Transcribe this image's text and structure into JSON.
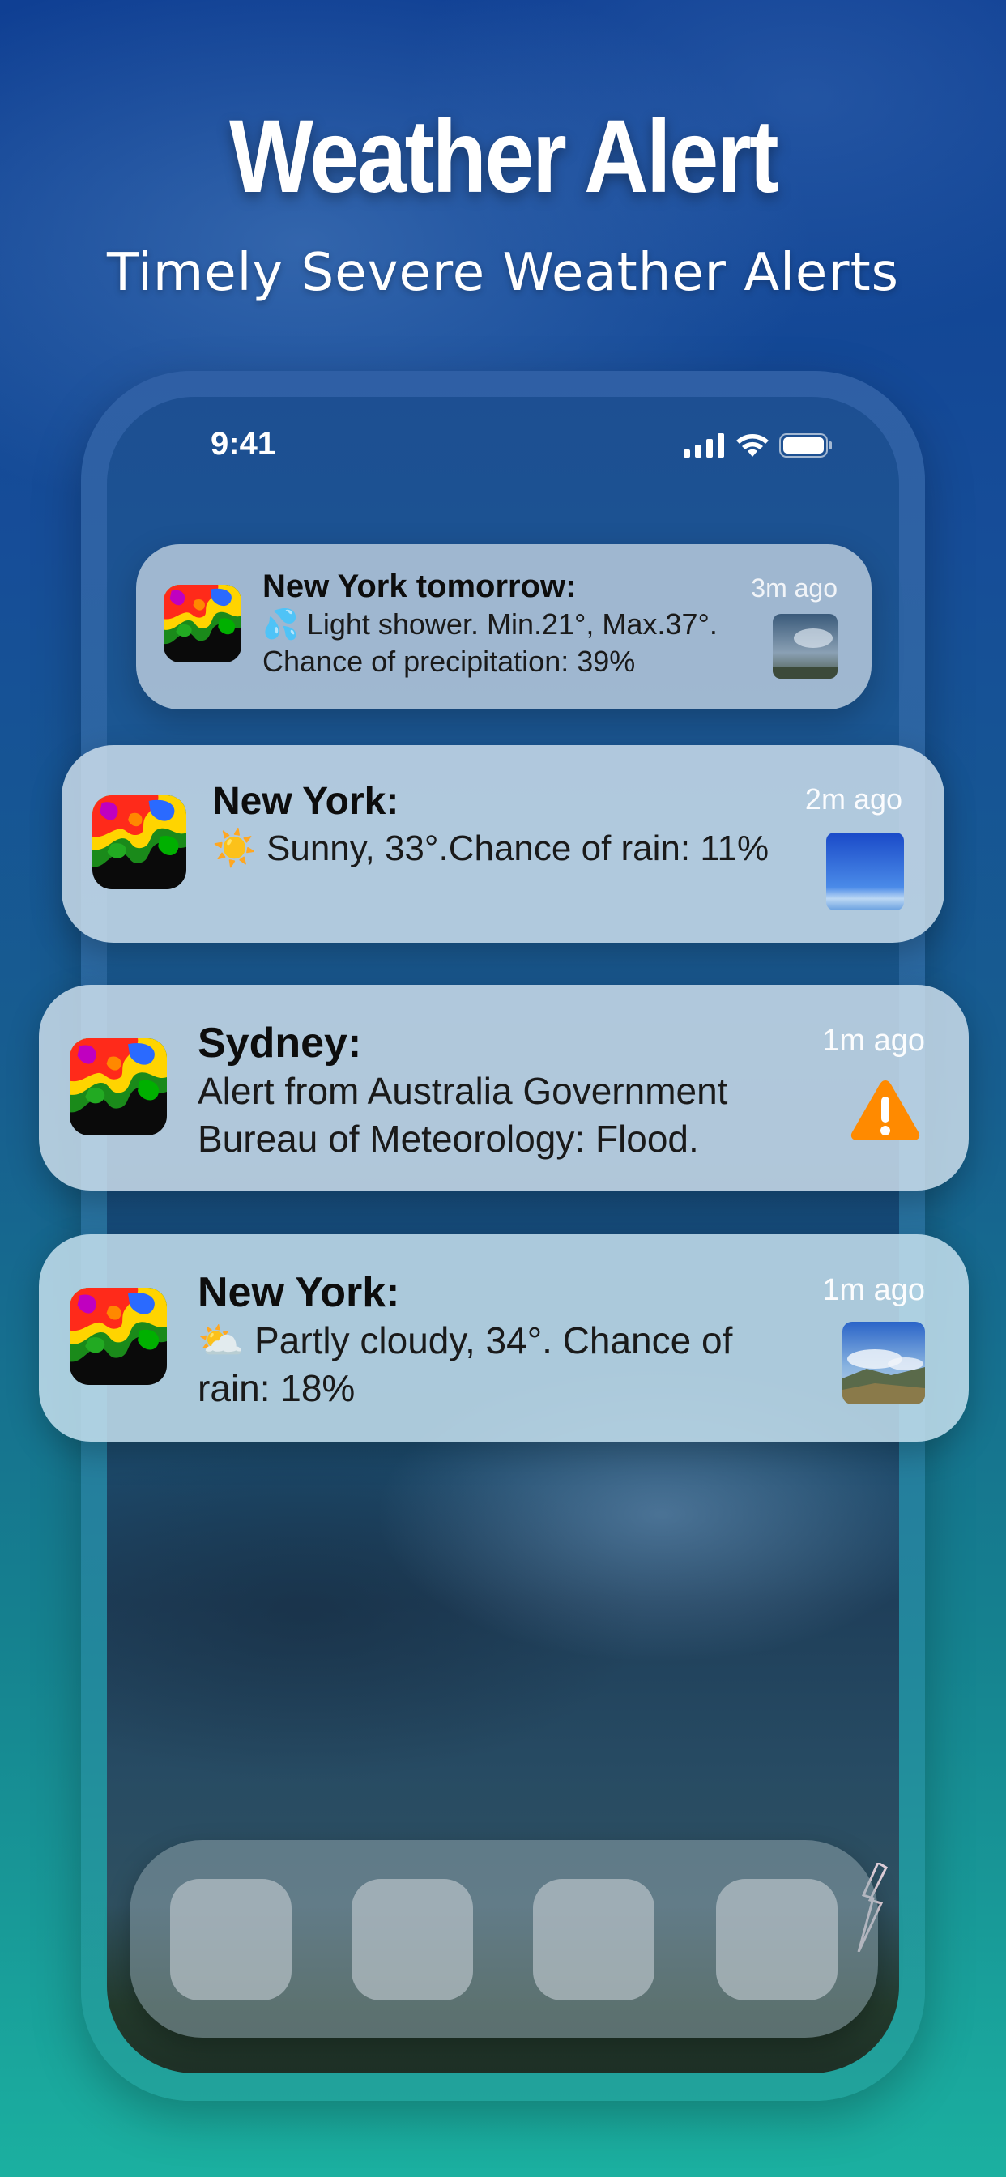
{
  "header": {
    "title": "Weather Alert",
    "subtitle": "Timely Severe Weather Alerts"
  },
  "status_bar": {
    "time": "9:41",
    "icons": [
      "signal-icon",
      "wifi-icon",
      "battery-icon"
    ]
  },
  "notifications": [
    {
      "title": "New York tomorrow:",
      "body_line1": "💦 Light shower. Min.21°, Max.37°.",
      "body_line2": "Chance of precipitation: 39%",
      "time": "3m ago",
      "thumbnail": "cloudy-sky-photo"
    },
    {
      "title": "New York:",
      "body": "☀️ Sunny, 33°.Chance of rain: 11%",
      "time": "2m ago",
      "thumbnail": "blue-sky-photo"
    },
    {
      "title": "Sydney:",
      "body_line1": "Alert from Australia Government",
      "body_line2": "Bureau of Meteorology: Flood.",
      "time": "1m ago",
      "icon": "warning-icon"
    },
    {
      "title": "New York:",
      "body_line1": "⛅ Partly cloudy, 34°. Chance of",
      "body_line2": "rain: 18%",
      "time": "1m ago",
      "thumbnail": "partly-cloudy-landscape-photo"
    }
  ],
  "dock": {
    "apps": [
      "dock-app-1",
      "dock-app-2",
      "dock-app-3",
      "dock-app-4"
    ]
  },
  "colors": {
    "warning": "#ff8a00",
    "background_top": "#0f3f93",
    "background_bottom": "#1bb0a0"
  }
}
